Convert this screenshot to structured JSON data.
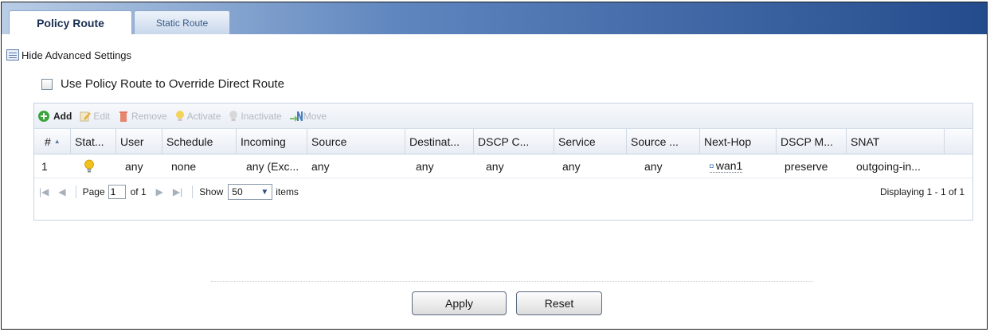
{
  "tabs": {
    "policy_route": "Policy Route",
    "static_route": "Static Route"
  },
  "advanced": {
    "label": "Hide Advanced Settings"
  },
  "override": {
    "label": "Use Policy Route to Override Direct Route",
    "checked": false
  },
  "toolbar": {
    "add": "Add",
    "edit": "Edit",
    "remove": "Remove",
    "activate": "Activate",
    "inactivate": "Inactivate",
    "move": "Move"
  },
  "table": {
    "headers": [
      "#",
      "Stat...",
      "User",
      "Schedule",
      "Incoming",
      "Source",
      "Destinat...",
      "DSCP C...",
      "Service",
      "Source ...",
      "Next-Hop",
      "DSCP M...",
      "SNAT"
    ],
    "sort_indicator": "▲",
    "rows": [
      {
        "num": "1",
        "status": "active-bulb",
        "user": "any",
        "schedule": "none",
        "incoming": "any (Exc...",
        "source": "any",
        "destination": "any",
        "dscp_code": "any",
        "service": "any",
        "source_port": "any",
        "next_hop": "wan1",
        "dscp_marking": "preserve",
        "snat": "outgoing-in..."
      }
    ]
  },
  "pager": {
    "page_label": "Page",
    "page_value": "1",
    "of_label": "of 1",
    "show_label": "Show",
    "show_value": "50",
    "items_label": "items",
    "display_text": "Displaying 1 - 1 of 1"
  },
  "buttons": {
    "apply": "Apply",
    "reset": "Reset"
  },
  "colors": {
    "tabbar_dark": "#244b8c",
    "bulb": "#f2c21b",
    "add_green": "#3aa53a",
    "remove_red": "#d9533b"
  }
}
